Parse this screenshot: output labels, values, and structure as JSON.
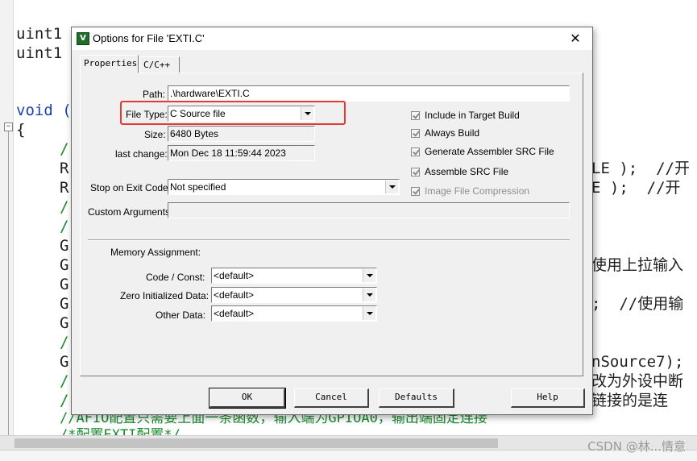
{
  "editor": {
    "lines": [
      {
        "text": "uint1",
        "cls": ""
      },
      {
        "text": "uint1",
        "cls": ""
      },
      {
        "text": "void (",
        "cls": "kw"
      },
      {
        "text": "{",
        "cls": ""
      },
      {
        "text": "/",
        "cls": "cm"
      },
      {
        "text": "R",
        "cls": ""
      },
      {
        "text": "R",
        "cls": ""
      },
      {
        "text": "/",
        "cls": "cm"
      },
      {
        "text": "/",
        "cls": "cm"
      },
      {
        "text": "G",
        "cls": ""
      },
      {
        "text": "G",
        "cls": ""
      },
      {
        "text": "G",
        "cls": ""
      },
      {
        "text": "G",
        "cls": ""
      },
      {
        "text": "G",
        "cls": ""
      },
      {
        "text": "/",
        "cls": "cm"
      },
      {
        "text": "G",
        "cls": ""
      },
      {
        "text": "/",
        "cls": "cm"
      },
      {
        "text": "/",
        "cls": "cm"
      },
      {
        "text": "//AFIO配置只需要上面一条函数，输入端为GPIOA0，输出端固定连接",
        "cls": "cm"
      },
      {
        "text": "/*配置EXTI配置*/",
        "cls": "cm"
      }
    ],
    "right_fragments": [
      "LE );  //开",
      "E );  //开",
      "使用上拉输入",
      ";  //使用输",
      "nSource7);",
      "改为外设中断",
      "链接的是连"
    ],
    "fold_marker": "−"
  },
  "watermark": "CSDN @林...情意",
  "dialog": {
    "title": "Options for File 'EXTI.C'",
    "app_icon_letter": "V",
    "close_glyph": "✕",
    "tabs": [
      "Properties",
      "C/C++"
    ],
    "path": {
      "label": "Path:",
      "value": ".\\hardware\\EXTI.C"
    },
    "file_type": {
      "label": "File Type:",
      "value": "C Source file"
    },
    "size": {
      "label": "Size:",
      "value": "6480 Bytes"
    },
    "last_change": {
      "label": "last change:",
      "value": "Mon Dec 18 11:59:44 2023"
    },
    "stop_on_exit": {
      "label": "Stop on Exit Code:",
      "value": "Not specified"
    },
    "custom_args": {
      "label": "Custom Arguments:",
      "value": ""
    },
    "checks": [
      {
        "label": "Include in Target Build",
        "checked": true,
        "disabled": false
      },
      {
        "label": "Always Build",
        "checked": true,
        "disabled": false
      },
      {
        "label": "Generate Assembler SRC File",
        "checked": true,
        "disabled": false
      },
      {
        "label": "Assemble SRC File",
        "checked": true,
        "disabled": false
      },
      {
        "label": "Image File Compression",
        "checked": true,
        "disabled": true
      }
    ],
    "memory": {
      "heading": "Memory Assignment:",
      "code_const": {
        "label": "Code / Const:",
        "value": "<default>"
      },
      "zero_init": {
        "label": "Zero Initialized Data:",
        "value": "<default>"
      },
      "other": {
        "label": "Other Data:",
        "value": "<default>"
      }
    },
    "buttons": {
      "ok": "OK",
      "cancel": "Cancel",
      "defaults": "Defaults",
      "help": "Help"
    },
    "highlight_color": "#e53935"
  }
}
